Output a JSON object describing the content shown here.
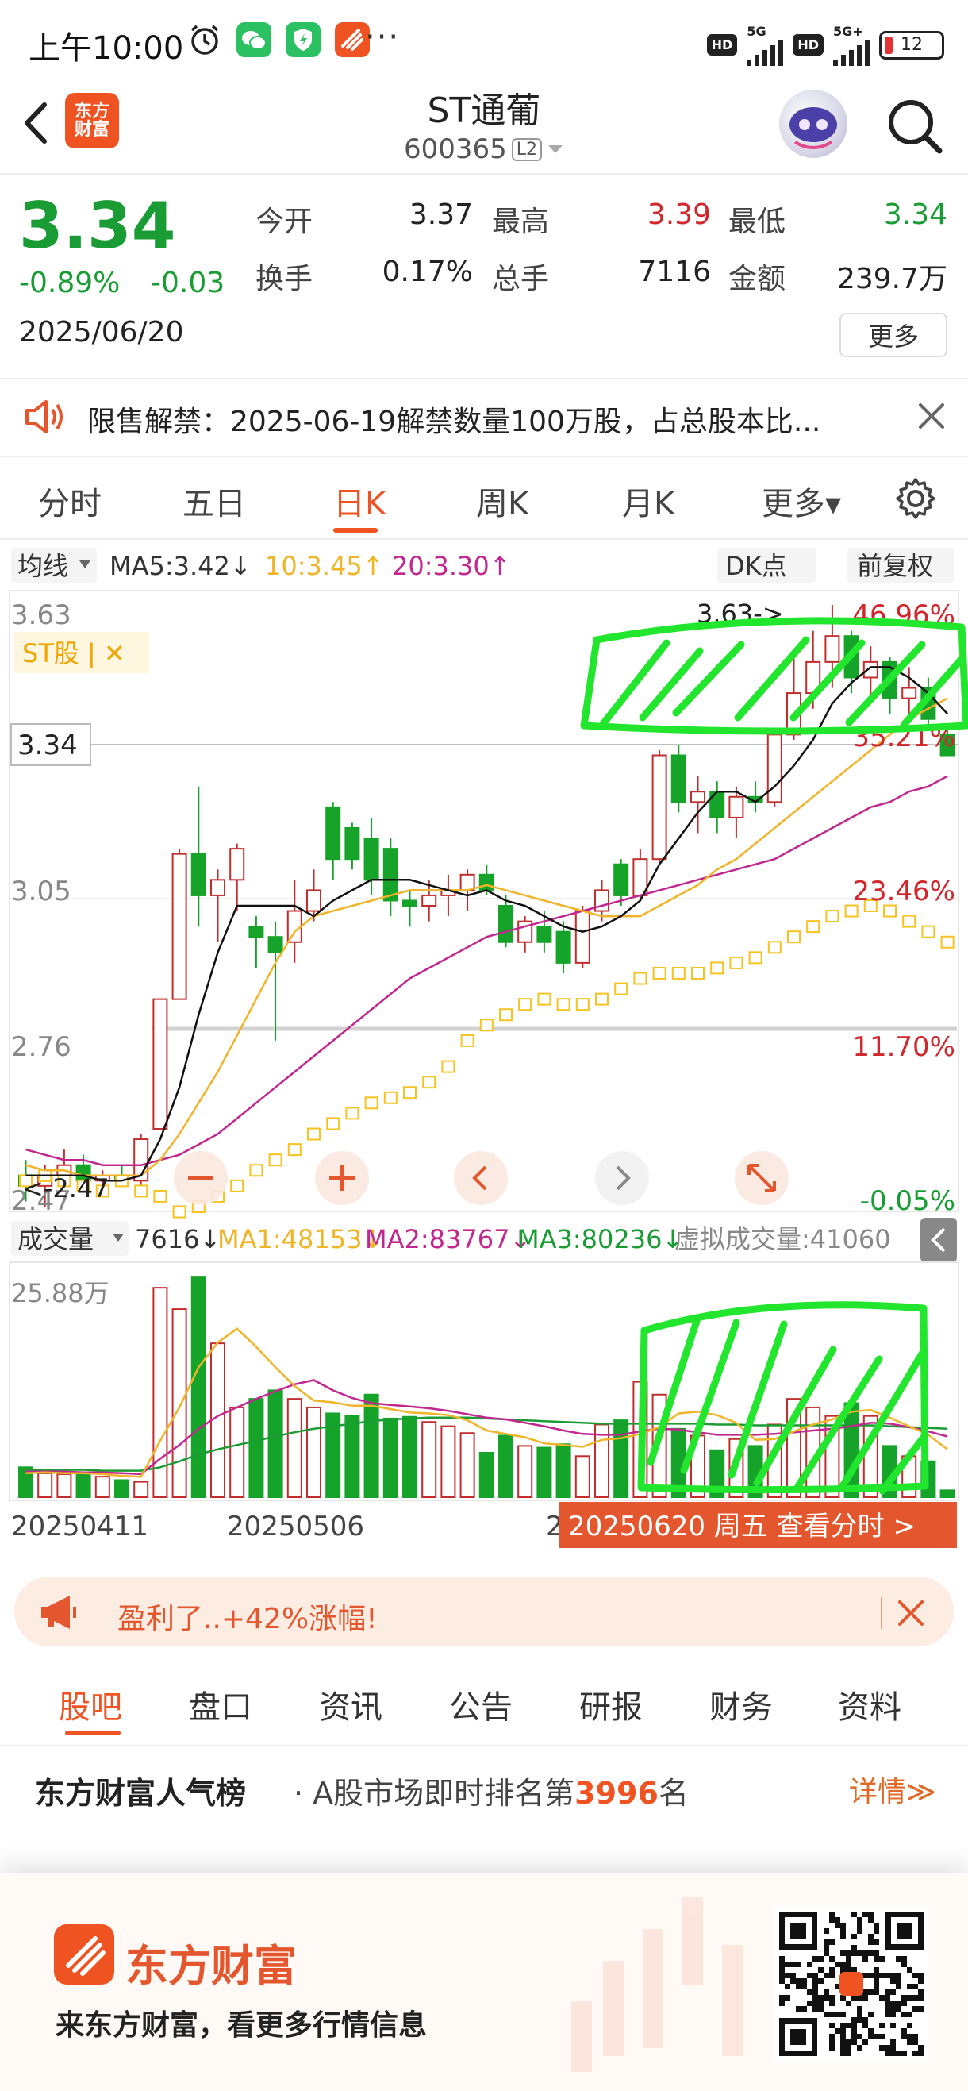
{
  "status_bar": {
    "time": "上午10:00",
    "dots": "···",
    "network1": "5G",
    "network2": "5G+",
    "hd": "HD",
    "battery": "12"
  },
  "header": {
    "logo_line1": "东方",
    "logo_line2": "财富",
    "stock_name": "ST通葡",
    "stock_code": "600365",
    "level_badge": "L2"
  },
  "quote": {
    "price": "3.34",
    "change_pct": "-0.89%",
    "change_abs": "-0.03",
    "date": "2025/06/20",
    "open_label": "今开",
    "open_value": "3.37",
    "high_label": "最高",
    "high_value": "3.39",
    "low_label": "最低",
    "low_value": "3.34",
    "turnover_label": "换手",
    "turnover_value": "0.17%",
    "volume_label": "总手",
    "volume_value": "7116",
    "amount_label": "金额",
    "amount_value": "239.7万",
    "more_label": "更多"
  },
  "notice": {
    "text": "限售解禁：2025-06-19解禁数量100万股，占总股本比..."
  },
  "period_tabs": [
    {
      "label": "分时"
    },
    {
      "label": "五日"
    },
    {
      "label": "日K"
    },
    {
      "label": "周K"
    },
    {
      "label": "月K"
    },
    {
      "label": "更多▾"
    }
  ],
  "kline": {
    "ma_selector": "均线",
    "ma5": "MA5:3.42↓",
    "ma10": "10:3.45↑",
    "ma20": "20:3.30↑",
    "dk_label": "DK点",
    "adjust_label": "前复权",
    "st_tag": "ST股 | ✕",
    "price_ticks": [
      "3.63",
      "3.05",
      "2.76",
      "2.47"
    ],
    "pct_ticks": [
      "46.96%",
      "35.21%",
      "23.46%",
      "11.70%",
      "-0.05%"
    ],
    "current_price_label": "3.34",
    "high_marker": "3.63->",
    "low_marker": "<-2.47",
    "colors": {
      "up": "#c22d2d",
      "down": "#16a329",
      "ma5": "#111111",
      "ma10": "#f0b429",
      "ma20": "#c2278f",
      "dk": "#f6c321"
    }
  },
  "volume": {
    "selector": "成交量",
    "current": "7616↓",
    "ma1": "MA1:48153↓",
    "ma2": "MA2:83767↓",
    "ma3": "MA3:80236↓",
    "virtual": "虚拟成交量:41060",
    "max_label": "25.88万",
    "date_left": "20250411",
    "date_mid": "20250506",
    "date_stub": "2",
    "date_banner": "20250620 周五 查看分时 >"
  },
  "promo": {
    "text": "盈利了..+42%涨幅!"
  },
  "bottom_tabs": [
    {
      "label": "股吧"
    },
    {
      "label": "盘口"
    },
    {
      "label": "资讯"
    },
    {
      "label": "公告"
    },
    {
      "label": "研报"
    },
    {
      "label": "财务"
    },
    {
      "label": "资料"
    }
  ],
  "rank": {
    "title": "东方财富人气榜",
    "prefix": "· A股市场即时排名第",
    "number": "3996",
    "suffix": "名",
    "link": "详情≫"
  },
  "footer": {
    "brand": "东方财富",
    "slogan": "来东方财富，看更多行情信息"
  },
  "chart_data": {
    "type": "candlestick",
    "ylim": [
      2.47,
      3.63
    ],
    "price_ticks": [
      3.63,
      3.05,
      2.76,
      2.47
    ],
    "x_labels": [
      "20250411",
      "20250506"
    ],
    "candles": [
      {
        "o": 2.53,
        "h": 2.56,
        "l": 2.48,
        "c": 2.51
      },
      {
        "o": 2.51,
        "h": 2.55,
        "l": 2.47,
        "c": 2.53
      },
      {
        "o": 2.53,
        "h": 2.58,
        "l": 2.51,
        "c": 2.55
      },
      {
        "o": 2.55,
        "h": 2.57,
        "l": 2.51,
        "c": 2.52
      },
      {
        "o": 2.52,
        "h": 2.54,
        "l": 2.5,
        "c": 2.53
      },
      {
        "o": 2.53,
        "h": 2.55,
        "l": 2.51,
        "c": 2.52
      },
      {
        "o": 2.52,
        "h": 2.61,
        "l": 2.51,
        "c": 2.6
      },
      {
        "o": 2.62,
        "h": 2.87,
        "l": 2.62,
        "c": 2.87
      },
      {
        "o": 2.87,
        "h": 3.16,
        "l": 2.87,
        "c": 3.15
      },
      {
        "o": 3.15,
        "h": 3.28,
        "l": 3.01,
        "c": 3.07
      },
      {
        "o": 3.07,
        "h": 3.12,
        "l": 2.98,
        "c": 3.1
      },
      {
        "o": 3.1,
        "h": 3.17,
        "l": 3.04,
        "c": 3.16
      },
      {
        "o": 3.01,
        "h": 3.03,
        "l": 2.93,
        "c": 2.99
      },
      {
        "o": 2.99,
        "h": 3.02,
        "l": 2.79,
        "c": 2.96
      },
      {
        "o": 2.98,
        "h": 3.1,
        "l": 2.94,
        "c": 3.04
      },
      {
        "o": 3.04,
        "h": 3.12,
        "l": 3.02,
        "c": 3.08
      },
      {
        "o": 3.24,
        "h": 3.25,
        "l": 3.1,
        "c": 3.14
      },
      {
        "o": 3.2,
        "h": 3.21,
        "l": 3.12,
        "c": 3.14
      },
      {
        "o": 3.18,
        "h": 3.22,
        "l": 3.07,
        "c": 3.1
      },
      {
        "o": 3.16,
        "h": 3.18,
        "l": 3.03,
        "c": 3.06
      },
      {
        "o": 3.06,
        "h": 3.08,
        "l": 3.01,
        "c": 3.05
      },
      {
        "o": 3.05,
        "h": 3.1,
        "l": 3.02,
        "c": 3.07
      },
      {
        "o": 3.07,
        "h": 3.11,
        "l": 3.03,
        "c": 3.08
      },
      {
        "o": 3.08,
        "h": 3.12,
        "l": 3.04,
        "c": 3.11
      },
      {
        "o": 3.11,
        "h": 3.13,
        "l": 3.07,
        "c": 3.08
      },
      {
        "o": 3.05,
        "h": 3.07,
        "l": 2.97,
        "c": 2.98
      },
      {
        "o": 2.98,
        "h": 3.03,
        "l": 2.96,
        "c": 3.02
      },
      {
        "o": 3.01,
        "h": 3.04,
        "l": 2.96,
        "c": 2.98
      },
      {
        "o": 3.0,
        "h": 3.02,
        "l": 2.92,
        "c": 2.94
      },
      {
        "o": 2.94,
        "h": 3.05,
        "l": 2.93,
        "c": 3.04
      },
      {
        "o": 3.04,
        "h": 3.1,
        "l": 3.02,
        "c": 3.08
      },
      {
        "o": 3.13,
        "h": 3.14,
        "l": 3.05,
        "c": 3.07
      },
      {
        "o": 3.07,
        "h": 3.16,
        "l": 3.06,
        "c": 3.14
      },
      {
        "o": 3.14,
        "h": 3.35,
        "l": 3.13,
        "c": 3.34
      },
      {
        "o": 3.34,
        "h": 3.36,
        "l": 3.23,
        "c": 3.25
      },
      {
        "o": 3.25,
        "h": 3.3,
        "l": 3.19,
        "c": 3.27
      },
      {
        "o": 3.27,
        "h": 3.29,
        "l": 3.19,
        "c": 3.22
      },
      {
        "o": 3.22,
        "h": 3.28,
        "l": 3.18,
        "c": 3.26
      },
      {
        "o": 3.26,
        "h": 3.29,
        "l": 3.23,
        "c": 3.25
      },
      {
        "o": 3.25,
        "h": 3.39,
        "l": 3.24,
        "c": 3.38
      },
      {
        "o": 3.38,
        "h": 3.53,
        "l": 3.37,
        "c": 3.46
      },
      {
        "o": 3.46,
        "h": 3.58,
        "l": 3.43,
        "c": 3.52
      },
      {
        "o": 3.52,
        "h": 3.63,
        "l": 3.47,
        "c": 3.57
      },
      {
        "o": 3.57,
        "h": 3.58,
        "l": 3.46,
        "c": 3.49
      },
      {
        "o": 3.49,
        "h": 3.55,
        "l": 3.44,
        "c": 3.52
      },
      {
        "o": 3.52,
        "h": 3.53,
        "l": 3.42,
        "c": 3.45
      },
      {
        "o": 3.45,
        "h": 3.51,
        "l": 3.41,
        "c": 3.47
      },
      {
        "o": 3.47,
        "h": 3.49,
        "l": 3.39,
        "c": 3.41
      },
      {
        "o": 3.38,
        "h": 3.39,
        "l": 3.34,
        "c": 3.34
      }
    ],
    "ma5": [
      2.53,
      2.53,
      2.53,
      2.53,
      2.52,
      2.52,
      2.53,
      2.6,
      2.7,
      2.84,
      2.96,
      3.05,
      3.05,
      3.05,
      3.05,
      3.03,
      3.06,
      3.08,
      3.1,
      3.1,
      3.1,
      3.09,
      3.08,
      3.07,
      3.08,
      3.06,
      3.05,
      3.03,
      3.01,
      3.0,
      3.01,
      3.03,
      3.06,
      3.13,
      3.18,
      3.23,
      3.27,
      3.27,
      3.25,
      3.28,
      3.32,
      3.37,
      3.44,
      3.48,
      3.51,
      3.51,
      3.49,
      3.46,
      3.42
    ],
    "ma10": [
      2.55,
      2.54,
      2.54,
      2.53,
      2.53,
      2.53,
      2.53,
      2.56,
      2.61,
      2.67,
      2.73,
      2.8,
      2.87,
      2.94,
      3.0,
      3.03,
      3.04,
      3.05,
      3.06,
      3.07,
      3.08,
      3.08,
      3.08,
      3.08,
      3.09,
      3.08,
      3.07,
      3.06,
      3.05,
      3.04,
      3.03,
      3.03,
      3.03,
      3.05,
      3.07,
      3.09,
      3.12,
      3.14,
      3.17,
      3.2,
      3.23,
      3.26,
      3.29,
      3.32,
      3.35,
      3.38,
      3.41,
      3.43,
      3.45
    ],
    "ma20": [
      2.58,
      2.57,
      2.56,
      2.56,
      2.55,
      2.55,
      2.55,
      2.56,
      2.57,
      2.59,
      2.61,
      2.64,
      2.67,
      2.7,
      2.73,
      2.76,
      2.79,
      2.82,
      2.85,
      2.88,
      2.91,
      2.93,
      2.95,
      2.97,
      2.99,
      3.0,
      3.01,
      3.02,
      3.03,
      3.04,
      3.05,
      3.06,
      3.07,
      3.08,
      3.09,
      3.1,
      3.11,
      3.12,
      3.13,
      3.14,
      3.16,
      3.18,
      3.2,
      3.22,
      3.24,
      3.25,
      3.27,
      3.28,
      3.3
    ],
    "dk": [
      2.52,
      2.53,
      2.52,
      2.51,
      2.5,
      2.52,
      2.5,
      2.49,
      2.46,
      2.47,
      2.49,
      2.51,
      2.54,
      2.56,
      2.58,
      2.61,
      2.63,
      2.65,
      2.67,
      2.68,
      2.69,
      2.71,
      2.74,
      2.79,
      2.82,
      2.84,
      2.86,
      2.87,
      2.86,
      2.86,
      2.87,
      2.89,
      2.91,
      2.92,
      2.92,
      2.92,
      2.93,
      2.94,
      2.95,
      2.97,
      2.99,
      3.01,
      3.03,
      3.04,
      3.05,
      3.04,
      3.02,
      3.0,
      2.98
    ],
    "volumes": [
      0.35,
      0.28,
      0.27,
      0.26,
      0.24,
      0.2,
      0.18,
      2.45,
      2.2,
      2.58,
      1.8,
      1.05,
      1.15,
      1.25,
      1.15,
      1.05,
      0.98,
      0.95,
      1.2,
      0.92,
      0.94,
      0.88,
      0.83,
      0.75,
      0.52,
      0.72,
      0.6,
      0.58,
      0.62,
      0.48,
      0.85,
      0.9,
      1.35,
      1.2,
      0.8,
      0.72,
      0.55,
      0.68,
      0.6,
      0.85,
      1.15,
      1.05,
      0.95,
      1.1,
      0.95,
      0.6,
      0.48,
      0.42,
      0.08
    ],
    "vol_ma1": [
      0.28,
      0.29,
      0.28,
      0.28,
      0.27,
      0.25,
      0.24,
      0.66,
      1.05,
      1.52,
      1.81,
      1.97,
      1.76,
      1.52,
      1.3,
      1.13,
      1.11,
      1.07,
      1.07,
      1.03,
      0.99,
      0.98,
      0.96,
      0.9,
      0.78,
      0.74,
      0.7,
      0.63,
      0.61,
      0.59,
      0.67,
      0.69,
      0.74,
      0.82,
      0.98,
      1.0,
      0.96,
      0.87,
      0.67,
      0.68,
      0.77,
      0.85,
      0.91,
      1.0,
      1.02,
      0.93,
      0.83,
      0.73,
      0.56
    ],
    "vol_ma2": [
      0.3,
      0.3,
      0.3,
      0.29,
      0.29,
      0.28,
      0.27,
      0.45,
      0.61,
      0.8,
      0.95,
      1.05,
      1.15,
      1.24,
      1.32,
      1.37,
      1.25,
      1.16,
      1.1,
      1.08,
      1.06,
      1.04,
      1.01,
      0.97,
      0.93,
      0.91,
      0.87,
      0.83,
      0.78,
      0.74,
      0.73,
      0.73,
      0.77,
      0.8,
      0.79,
      0.76,
      0.73,
      0.73,
      0.73,
      0.74,
      0.76,
      0.78,
      0.8,
      0.83,
      0.87,
      0.86,
      0.82,
      0.77,
      0.71
    ],
    "vol_ma3": [
      0.32,
      0.32,
      0.32,
      0.32,
      0.31,
      0.31,
      0.31,
      0.35,
      0.42,
      0.5,
      0.56,
      0.61,
      0.66,
      0.71,
      0.76,
      0.8,
      0.83,
      0.86,
      0.89,
      0.91,
      0.92,
      0.93,
      0.93,
      0.93,
      0.92,
      0.91,
      0.9,
      0.89,
      0.88,
      0.87,
      0.86,
      0.86,
      0.86,
      0.86,
      0.86,
      0.86,
      0.85,
      0.85,
      0.84,
      0.84,
      0.84,
      0.84,
      0.84,
      0.84,
      0.84,
      0.83,
      0.82,
      0.81,
      0.8
    ]
  }
}
